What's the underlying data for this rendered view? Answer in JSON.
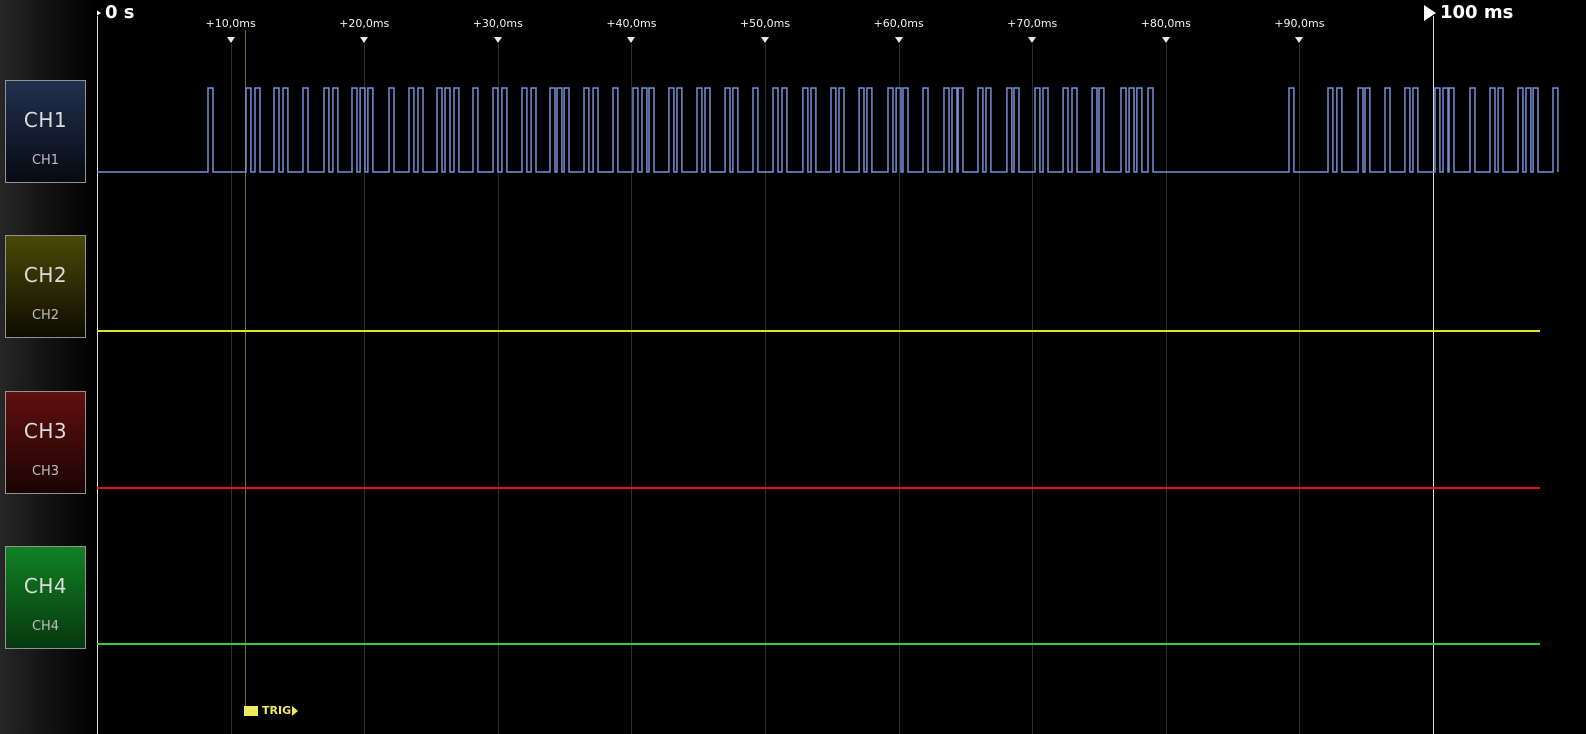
{
  "ruler": {
    "start_marker": "0 s",
    "end_marker": "100 ms",
    "ticks": [
      {
        "label": "+10,0ms",
        "ms": 10
      },
      {
        "label": "+20,0ms",
        "ms": 20
      },
      {
        "label": "+30,0ms",
        "ms": 30
      },
      {
        "label": "+40,0ms",
        "ms": 40
      },
      {
        "label": "+50,0ms",
        "ms": 50
      },
      {
        "label": "+60,0ms",
        "ms": 60
      },
      {
        "label": "+70,0ms",
        "ms": 70
      },
      {
        "label": "+80,0ms",
        "ms": 80
      },
      {
        "label": "+90,0ms",
        "ms": 90
      }
    ]
  },
  "sidebar": {
    "channels": [
      {
        "id": "ch1",
        "label": "CH1",
        "sublabel": "CH1",
        "color": "#7490d6",
        "button_top": "#22304f",
        "button_bottom": "#060a12"
      },
      {
        "id": "ch2",
        "label": "CH2",
        "sublabel": "CH2",
        "color": "#e2e222",
        "button_top": "#4b4906",
        "button_bottom": "#0d0c01"
      },
      {
        "id": "ch3",
        "label": "CH3",
        "sublabel": "CH3",
        "color": "#e51212",
        "button_top": "#600f0f",
        "button_bottom": "#1a0404"
      },
      {
        "id": "ch4",
        "label": "CH4",
        "sublabel": "CH4",
        "color": "#2fd032",
        "button_top": "#108223",
        "button_bottom": "#06380f"
      }
    ]
  },
  "trigger": {
    "label": "TRIG",
    "time_ms": 11.08,
    "tag_color": "#ecec5e",
    "line_color": "#73732d"
  },
  "chart_data": {
    "type": "line",
    "subtype": "logic-timeline",
    "x_axis": {
      "unit": "ms",
      "range_visible": [
        0,
        100
      ],
      "start_label": "0 s",
      "end_label": "100 ms",
      "tick_interval_ms": 10,
      "decimal_separator": ","
    },
    "grid": true,
    "trigger_time_ms": 11.08,
    "channels": [
      {
        "name": "CH1",
        "kind": "digital-pulses",
        "idle_level": "low",
        "pulse_width_ms": 0.37,
        "pulse_starts_ms": [
          8.31,
          11.15,
          11.83,
          13.25,
          13.92,
          15.42,
          16.99,
          17.66,
          19.09,
          19.69,
          20.28,
          21.86,
          23.35,
          24.03,
          25.45,
          26.05,
          26.72,
          28.14,
          29.64,
          30.31,
          31.81,
          32.49,
          33.91,
          34.43,
          34.96,
          36.45,
          37.13,
          38.62,
          40.12,
          40.79,
          41.32,
          42.81,
          43.41,
          44.91,
          45.51,
          47.01,
          47.6,
          49.1,
          50.6,
          51.27,
          52.84,
          53.44,
          54.94,
          55.54,
          57.04,
          57.63,
          59.21,
          59.81,
          60.33,
          61.83,
          63.4,
          64.0,
          64.45,
          65.94,
          66.54,
          68.11,
          68.64,
          70.21,
          70.81,
          72.31,
          72.98,
          74.48,
          75.0,
          76.65,
          77.25,
          77.84,
          78.67,
          89.22,
          92.14,
          92.81,
          94.39,
          94.91,
          96.41,
          97.9,
          98.5,
          100.15,
          100.75,
          101.2,
          102.77,
          104.27,
          104.87,
          106.36,
          106.96,
          107.49,
          108.98
        ]
      },
      {
        "name": "CH2",
        "kind": "flat",
        "level": "idle"
      },
      {
        "name": "CH3",
        "kind": "flat",
        "level": "idle"
      },
      {
        "name": "CH4",
        "kind": "flat",
        "level": "idle"
      }
    ]
  }
}
